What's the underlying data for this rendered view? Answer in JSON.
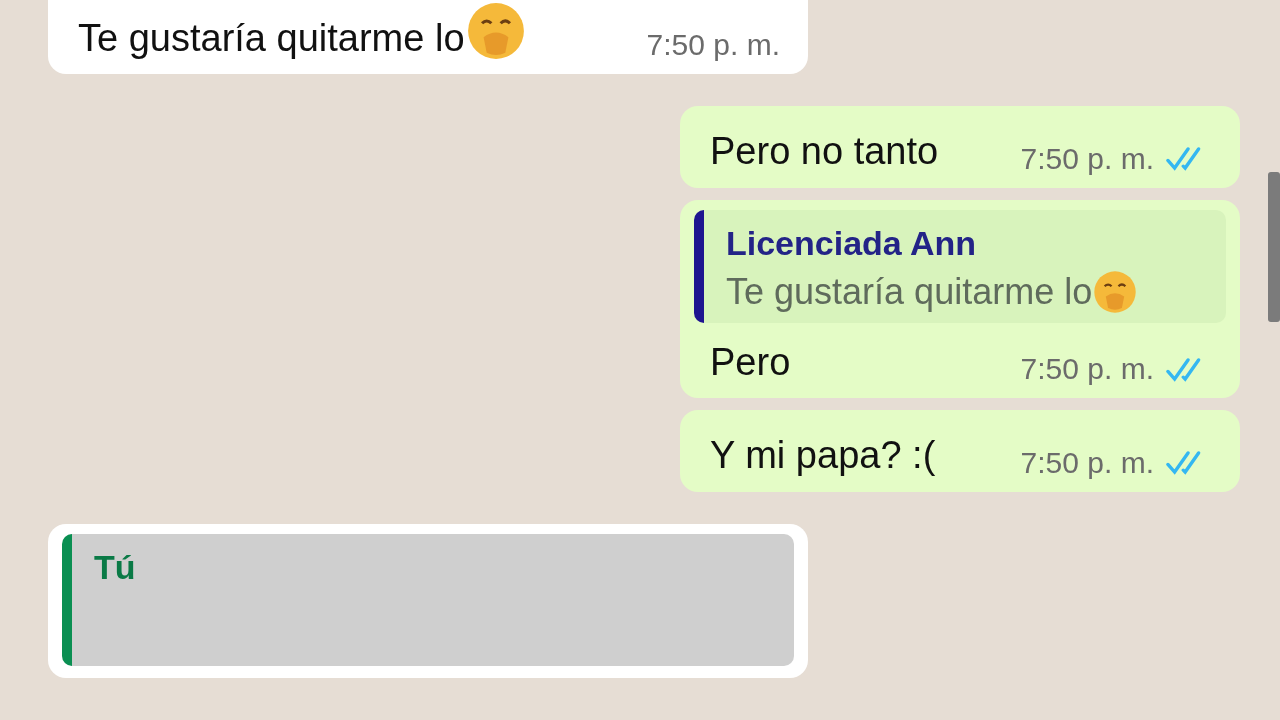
{
  "messages": [
    {
      "kind": "incoming",
      "text": "Te gustaría quitarme lo",
      "emoji": true,
      "time": "7:50 p. m."
    },
    {
      "kind": "outgoing",
      "text": "Pero no tanto",
      "time": "7:50 p. m.",
      "read": true
    },
    {
      "kind": "outgoing",
      "quote": {
        "author": "Licenciada Ann",
        "text": "Te gustaría quitarme lo",
        "emoji": true
      },
      "text": "Pero",
      "time": "7:50 p. m.",
      "read": true
    },
    {
      "kind": "outgoing",
      "text": "Y mi papa? :(",
      "time": "7:50 p. m.",
      "read": true
    },
    {
      "kind": "incoming",
      "quote": {
        "author": "Tú"
      }
    }
  ]
}
